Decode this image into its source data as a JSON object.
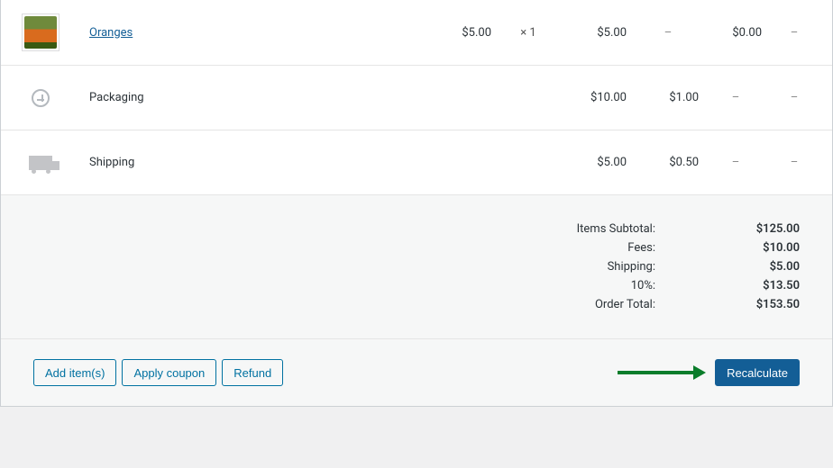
{
  "items": [
    {
      "name": "Oranges",
      "unit_price": "$5.00",
      "qty": "× 1",
      "line_total": "$5.00",
      "discount": "–",
      "net": "$0.00",
      "tail": "–"
    }
  ],
  "fees": [
    {
      "name": "Packaging",
      "amount": "$10.00",
      "tax": "$1.00"
    }
  ],
  "shipping": {
    "name": "Shipping",
    "amount": "$5.00",
    "tax": "$0.50"
  },
  "totals": {
    "items_subtotal_label": "Items Subtotal:",
    "items_subtotal_value": "$125.00",
    "fees_label": "Fees:",
    "fees_value": "$10.00",
    "shipping_label": "Shipping:",
    "shipping_value": "$5.00",
    "tax_label": "10%:",
    "tax_value": "$13.50",
    "order_total_label": "Order Total:",
    "order_total_value": "$153.50"
  },
  "actions": {
    "add_items": "Add item(s)",
    "apply_coupon": "Apply coupon",
    "refund": "Refund",
    "recalculate": "Recalculate"
  }
}
